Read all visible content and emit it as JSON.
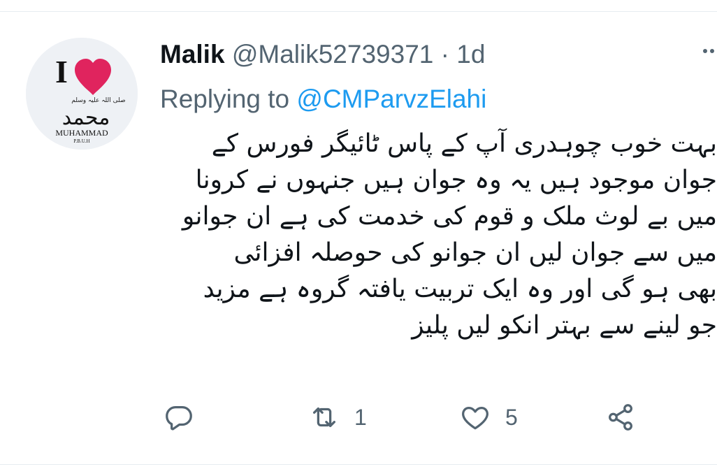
{
  "tweet": {
    "display_name": "Malik",
    "handle": "@Malik52739371",
    "separator": "·",
    "time": "1d",
    "replying_prefix": "Replying to ",
    "replying_to": "@CMParvzElahi",
    "text_lines": [
      "بہت خوب چوہدری آپ کے پاس ٹائیگر فورس کے",
      "جوان موجود ہیں یہ وہ جوان ہیں جنہوں نے کرونا",
      "میں بے لوث ملک و قوم کی خدمت کی ہے ان جوانو",
      "میں سے جوان لیں ان جوانو کی حوصلہ افزائی",
      "بھی ہو گی اور وہ ایک تربیت یافتہ گروہ ہے مزید",
      "جو لینے سے بہتر انکو لیں پلیز"
    ]
  },
  "avatar": {
    "heading": "I",
    "arabic_text": "محمد",
    "small_arabic": "صلی اللہ علیہ وسلم",
    "caption": "MUHAMMAD",
    "sub_caption": "P.B.U.H",
    "heart_color": "#e0245e"
  },
  "actions": {
    "reply": {
      "icon": "reply-icon",
      "count": ""
    },
    "retweet": {
      "icon": "retweet-icon",
      "count": "1"
    },
    "like": {
      "icon": "heart-icon",
      "count": "5"
    },
    "share": {
      "icon": "share-icon",
      "count": ""
    }
  },
  "colors": {
    "text": "#0f1419",
    "secondary": "#536471",
    "link": "#1d9bf0",
    "border": "#e6ecf0"
  }
}
